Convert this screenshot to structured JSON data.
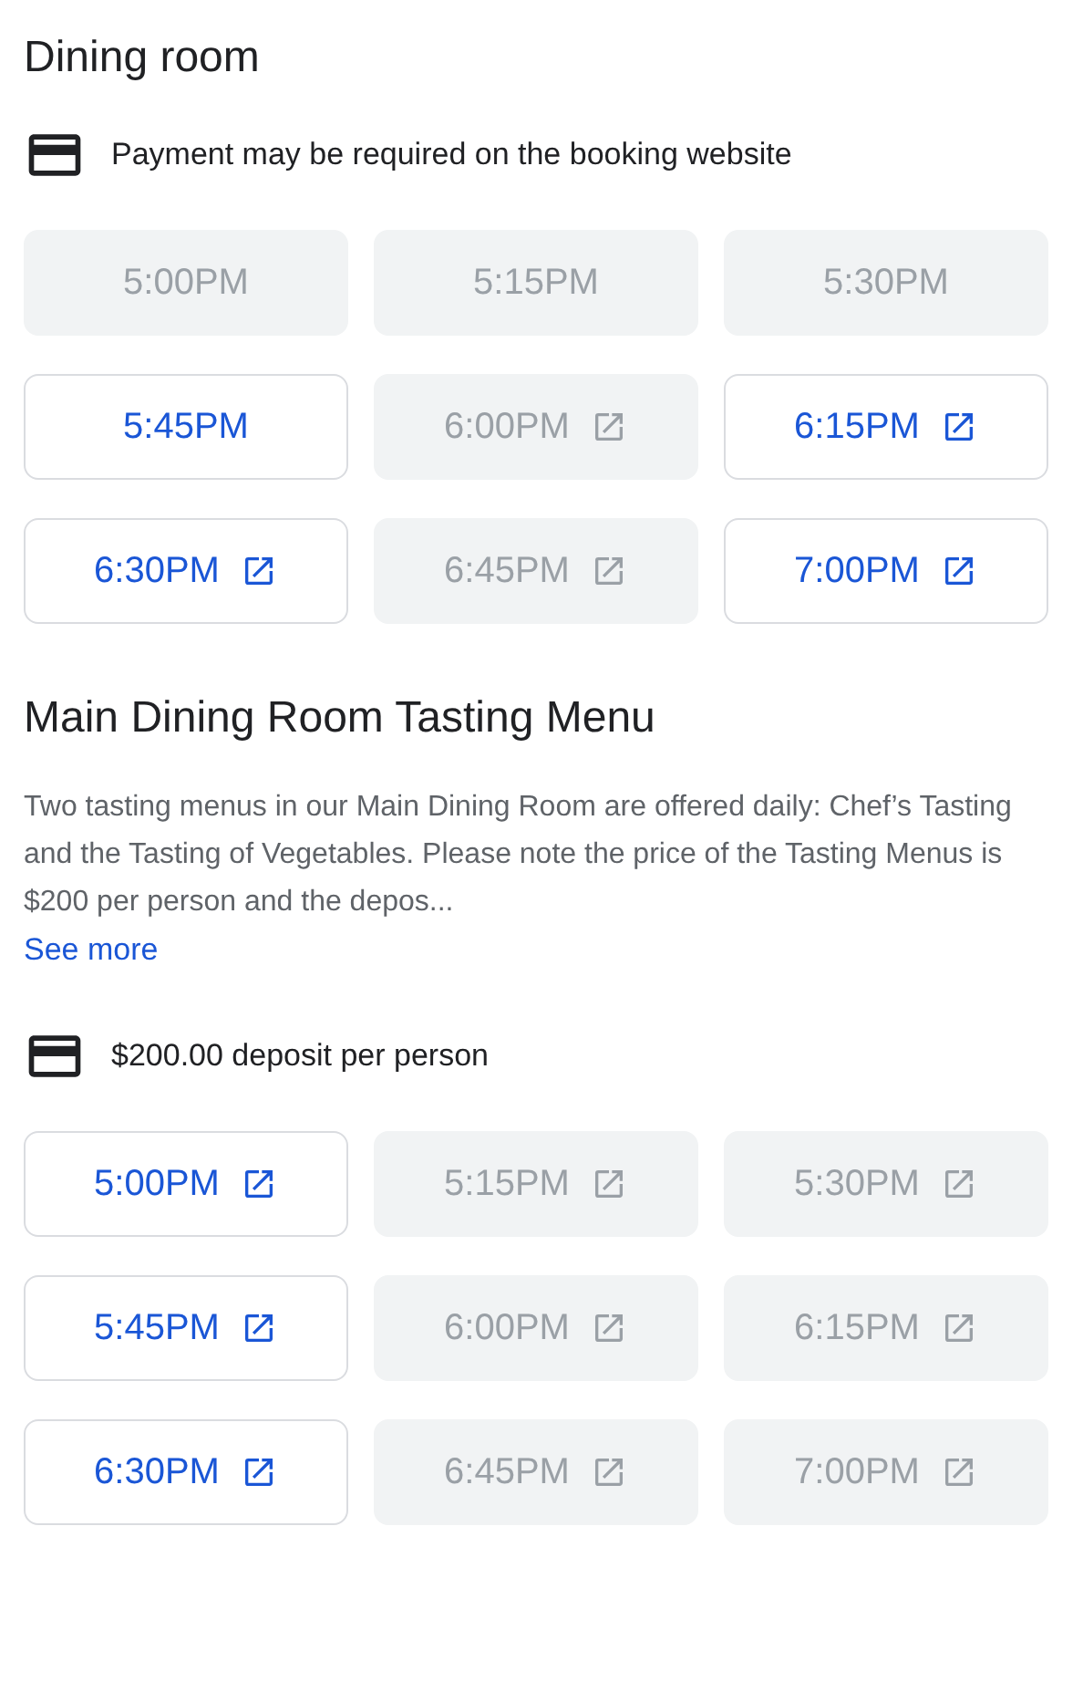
{
  "sections": [
    {
      "title": "Dining room",
      "note": "Payment may be required on the booking website",
      "slots": [
        {
          "time": "5:00PM",
          "available": false,
          "external": false
        },
        {
          "time": "5:15PM",
          "available": false,
          "external": false
        },
        {
          "time": "5:30PM",
          "available": false,
          "external": false
        },
        {
          "time": "5:45PM",
          "available": true,
          "external": false
        },
        {
          "time": "6:00PM",
          "available": false,
          "external": true
        },
        {
          "time": "6:15PM",
          "available": true,
          "external": true
        },
        {
          "time": "6:30PM",
          "available": true,
          "external": true
        },
        {
          "time": "6:45PM",
          "available": false,
          "external": true
        },
        {
          "time": "7:00PM",
          "available": true,
          "external": true
        }
      ]
    },
    {
      "title": "Main Dining Room Tasting Menu",
      "description": "Two tasting menus in our Main Dining Room are offered daily: Chef’s Tasting and the Tasting of Vegetables. Please note the price of the Tasting Menus is $200 per person and the depos...",
      "link": "See more",
      "note": "$200.00 deposit per person",
      "slots": [
        {
          "time": "5:00PM",
          "available": true,
          "external": true
        },
        {
          "time": "5:15PM",
          "available": false,
          "external": true
        },
        {
          "time": "5:30PM",
          "available": false,
          "external": true
        },
        {
          "time": "5:45PM",
          "available": true,
          "external": true
        },
        {
          "time": "6:00PM",
          "available": false,
          "external": true
        },
        {
          "time": "6:15PM",
          "available": false,
          "external": true
        },
        {
          "time": "6:30PM",
          "available": true,
          "external": true
        },
        {
          "time": "6:45PM",
          "available": false,
          "external": true
        },
        {
          "time": "7:00PM",
          "available": false,
          "external": true
        }
      ]
    }
  ]
}
